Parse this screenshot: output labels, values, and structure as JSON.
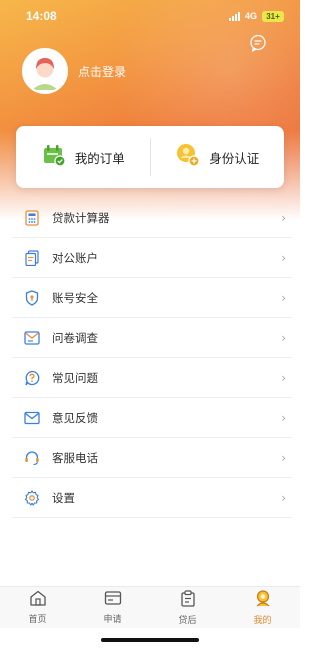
{
  "status_bar": {
    "time": "14:08",
    "network": "4G",
    "battery": "31+"
  },
  "profile": {
    "login_text": "点击登录"
  },
  "quick_cards": [
    {
      "label": "我的订单",
      "icon": "orders-icon"
    },
    {
      "label": "身份认证",
      "icon": "identity-icon"
    }
  ],
  "menu": {
    "items": [
      {
        "label": "贷款计算器",
        "icon": "calculator-icon"
      },
      {
        "label": "对公账户",
        "icon": "account-icon"
      },
      {
        "label": "账号安全",
        "icon": "shield-icon"
      },
      {
        "label": "问卷调查",
        "icon": "survey-icon"
      },
      {
        "label": "常见问题",
        "icon": "question-icon"
      },
      {
        "label": "意见反馈",
        "icon": "mail-icon"
      },
      {
        "label": "客服电话",
        "icon": "headset-icon"
      },
      {
        "label": "设置",
        "icon": "gear-icon"
      }
    ]
  },
  "tabbar": {
    "items": [
      {
        "label": "首页",
        "icon": "home-icon"
      },
      {
        "label": "申请",
        "icon": "apply-icon"
      },
      {
        "label": "贷后",
        "icon": "clipboard-icon"
      },
      {
        "label": "我的",
        "icon": "profile-icon"
      }
    ],
    "active": "我的"
  },
  "colors": {
    "accent": "#e08a2e",
    "header_start": "#f7b74a",
    "header_end": "#ea6a3a"
  }
}
